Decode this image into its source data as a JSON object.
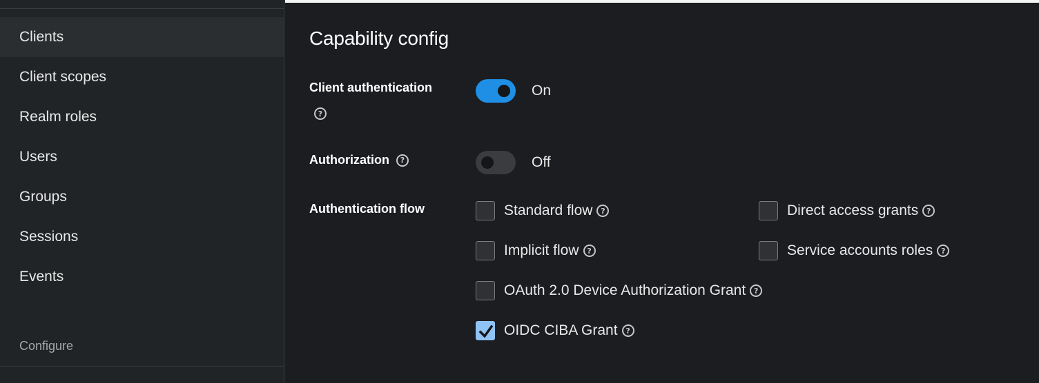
{
  "sidebar": {
    "items": [
      {
        "label": "Clients"
      },
      {
        "label": "Client scopes"
      },
      {
        "label": "Realm roles"
      },
      {
        "label": "Users"
      },
      {
        "label": "Groups"
      },
      {
        "label": "Sessions"
      },
      {
        "label": "Events"
      }
    ],
    "active": "Clients",
    "section_label": "Configure"
  },
  "main": {
    "title": "Capability config",
    "client_authentication": {
      "label": "Client authentication",
      "state": "On",
      "enabled": true
    },
    "authorization": {
      "label": "Authorization",
      "state": "Off",
      "enabled": false
    },
    "authentication_flow": {
      "label": "Authentication flow",
      "options": [
        {
          "label": "Standard flow",
          "checked": false
        },
        {
          "label": "Direct access grants",
          "checked": false
        },
        {
          "label": "Implicit flow",
          "checked": false
        },
        {
          "label": "Service accounts roles",
          "checked": false
        },
        {
          "label": "OAuth 2.0 Device Authorization Grant",
          "checked": false
        },
        {
          "label": "OIDC CIBA Grant",
          "checked": true
        }
      ]
    }
  },
  "colors": {
    "toggle_on": "#1f8fe6",
    "checkbox_checked": "#8fc3f5",
    "background": "#1b1d21",
    "sidebar": "#212427"
  },
  "icons": {
    "help": "question-circle-icon",
    "check": "checkmark-icon"
  }
}
